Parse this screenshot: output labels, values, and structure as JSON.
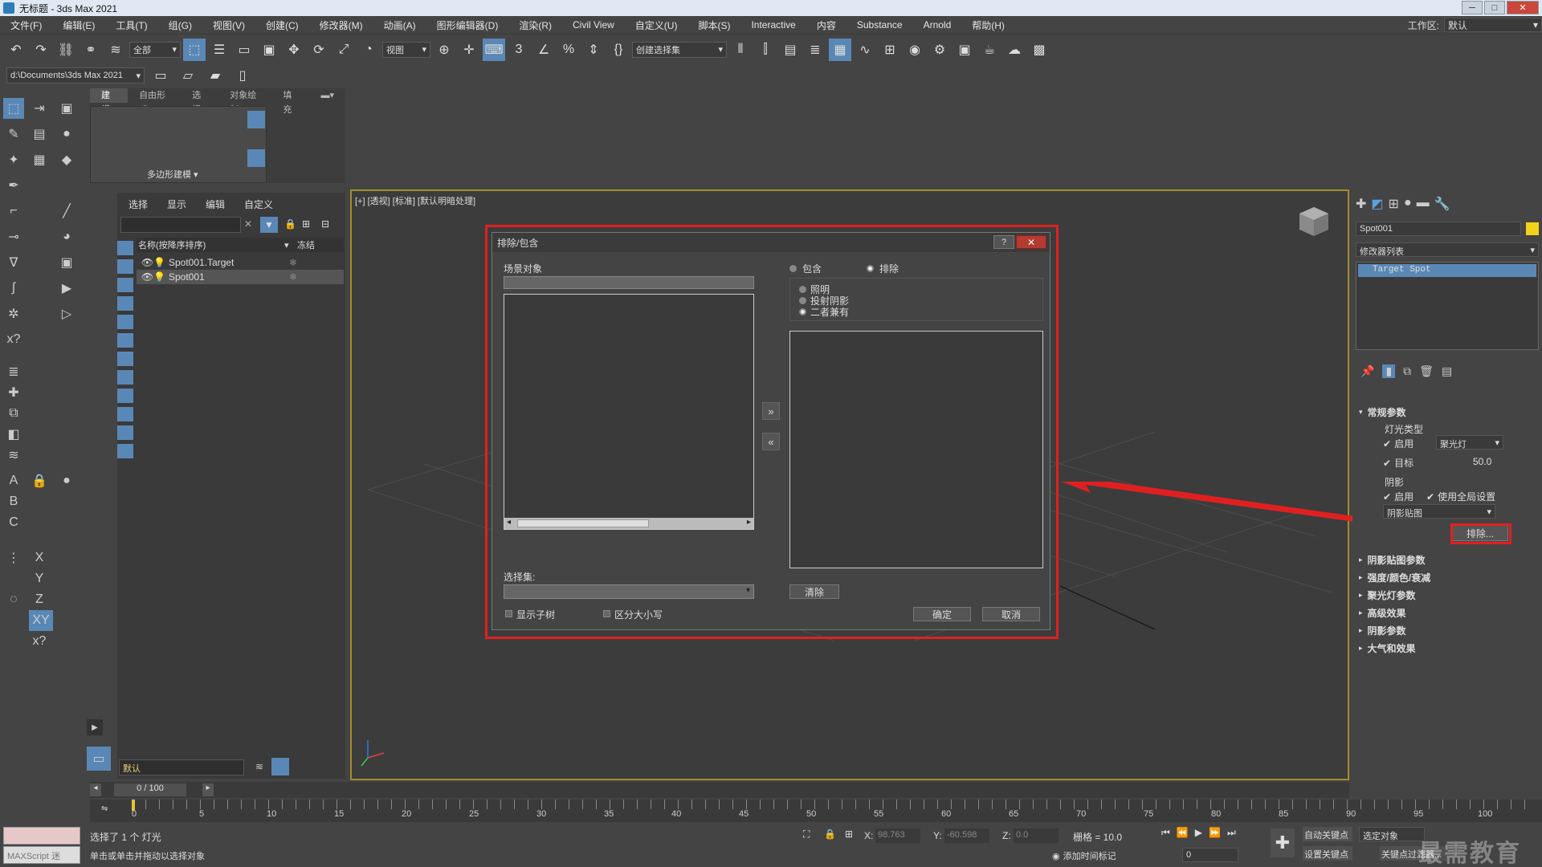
{
  "window": {
    "title": "无标题 - 3ds Max 2021",
    "min": "─",
    "max": "□",
    "close": "✕"
  },
  "menu": [
    "文件(F)",
    "编辑(E)",
    "工具(T)",
    "组(G)",
    "视图(V)",
    "创建(C)",
    "修改器(M)",
    "动画(A)",
    "图形编辑器(D)",
    "渲染(R)",
    "Civil View",
    "自定义(U)",
    "脚本(S)",
    "Interactive",
    "内容",
    "Substance",
    "Arnold",
    "帮助(H)"
  ],
  "workspace": {
    "label": "工作区:",
    "value": "默认"
  },
  "toolbar": {
    "filter_value": "全部",
    "refcoord_value": "视图",
    "selset_value": "创建选择集"
  },
  "project_path": "d:\\Documents\\3ds Max 2021",
  "ribbon": {
    "tabs": [
      "建模",
      "自由形式",
      "选择",
      "对象绘制",
      "填充"
    ],
    "panel_label": "多边形建模 ▾"
  },
  "scene": {
    "menu": [
      "选择",
      "显示",
      "编辑",
      "自定义"
    ],
    "col_name": "名称(按降序排序)",
    "col_freeze": "冻结",
    "rows": [
      {
        "name": "Spot001.Target",
        "selected": false
      },
      {
        "name": "Spot001",
        "selected": true
      }
    ],
    "layer": "默认"
  },
  "viewport": {
    "label": "[+] [透视] [标准] [默认明暗处理]"
  },
  "dialog": {
    "title": "排除/包含",
    "help": "?",
    "close": "✕",
    "scene_objects": "场景对象",
    "include": "包含",
    "exclude": "排除",
    "mode_lighting": "照明",
    "mode_shadow": "投射阴影",
    "mode_both": "二者兼有",
    "move_right": "»",
    "move_left": "«",
    "selset_label": "选择集:",
    "clear": "清除",
    "show_subtree": "显示子树",
    "case_sensitive": "区分大小写",
    "ok": "确定",
    "cancel": "取消"
  },
  "cmdpanel": {
    "object_name": "Spot001",
    "color": "#f2d21b",
    "modifier_list": "修改器列表",
    "stack_item": "Target Spot",
    "section_general": "常规参数",
    "light_type": "灯光类型",
    "enable": "启用",
    "light_type_value": "聚光灯",
    "target": "目标",
    "target_value": "50.0",
    "shadows": "阴影",
    "shadow_enable": "启用",
    "use_global": "使用全局设置",
    "shadow_type": "阴影贴图",
    "exclude_btn": "排除...",
    "sections": [
      "阴影贴图参数",
      "强度/颜色/衰减",
      "聚光灯参数",
      "高级效果",
      "阴影参数",
      "大气和效果"
    ]
  },
  "timeline": {
    "frame": "0 / 100",
    "ticks": [
      "0",
      "5",
      "10",
      "15",
      "20",
      "25",
      "30",
      "35",
      "40",
      "45",
      "50",
      "55",
      "60",
      "65",
      "70",
      "75",
      "80",
      "85",
      "90",
      "95",
      "100"
    ]
  },
  "status": {
    "line1": "选择了 1 个 灯光",
    "line2": "单击或单击并拖动以选择对象",
    "maxscript": "MAXScript 迷",
    "x_label": "X:",
    "x_value": "98.763",
    "y_label": "Y:",
    "y_value": "-60.598",
    "z_label": "Z:",
    "z_value": "0.0",
    "grid": "栅格 = 10.0",
    "add_time_tag": "添加时间标记",
    "auto_key": "自动关键点",
    "set_key": "设置关键点",
    "selected_obj": "选定对象",
    "key_filter": "关键点过滤器...",
    "frame_value": "0"
  },
  "watermark": "最需教育"
}
